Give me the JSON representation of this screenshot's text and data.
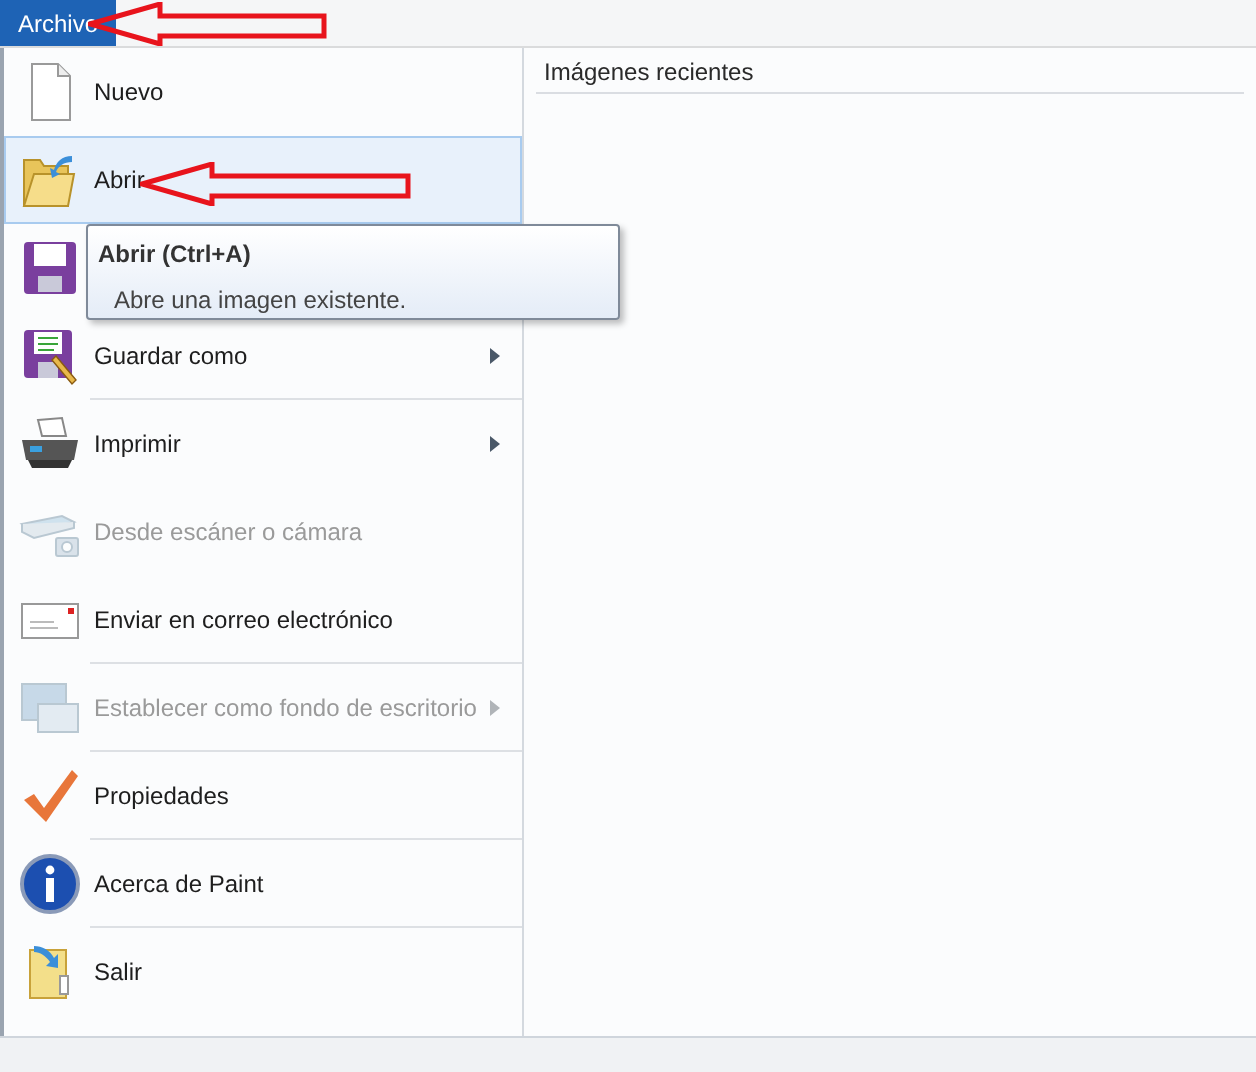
{
  "menu_tab": {
    "label": "Archivo",
    "selected": true
  },
  "menu_items": [
    {
      "kind": "new",
      "label": "Nuevo",
      "disabled": false,
      "highlighted": false,
      "submenu": false,
      "divider_after": false
    },
    {
      "kind": "open",
      "label": "Abrir",
      "disabled": false,
      "highlighted": true,
      "submenu": false,
      "divider_after": false
    },
    {
      "kind": "save",
      "disabled": false,
      "highlighted": false
    },
    {
      "kind": "save_as",
      "label": "Guardar como",
      "disabled": false,
      "highlighted": false,
      "submenu": true,
      "divider_after": true
    },
    {
      "kind": "print",
      "label": "Imprimir",
      "disabled": false,
      "highlighted": false,
      "submenu": true,
      "divider_after": false
    },
    {
      "kind": "scanner",
      "label": "Desde escáner o cámara",
      "disabled": true,
      "highlighted": false,
      "submenu": false,
      "divider_after": false
    },
    {
      "kind": "email",
      "label": "Enviar en correo electrónico",
      "disabled": false,
      "highlighted": false,
      "submenu": false,
      "divider_after": true
    },
    {
      "kind": "wallpaper",
      "label": "Establecer como fondo de escritorio",
      "disabled": true,
      "highlighted": false,
      "submenu": true,
      "divider_after": true
    },
    {
      "kind": "properties",
      "label": "Propiedades",
      "disabled": false,
      "highlighted": false,
      "submenu": false,
      "divider_after": true
    },
    {
      "kind": "about",
      "label": "Acerca de Paint",
      "disabled": false,
      "highlighted": false,
      "submenu": false,
      "divider_after": true
    },
    {
      "kind": "exit",
      "label": "Salir",
      "disabled": false,
      "highlighted": false,
      "submenu": false,
      "divider_after": false
    }
  ],
  "tooltip": {
    "title": "Abrir (Ctrl+A)",
    "description": "Abre una imagen existente."
  },
  "recent_panel": {
    "title": "Imágenes recientes"
  }
}
